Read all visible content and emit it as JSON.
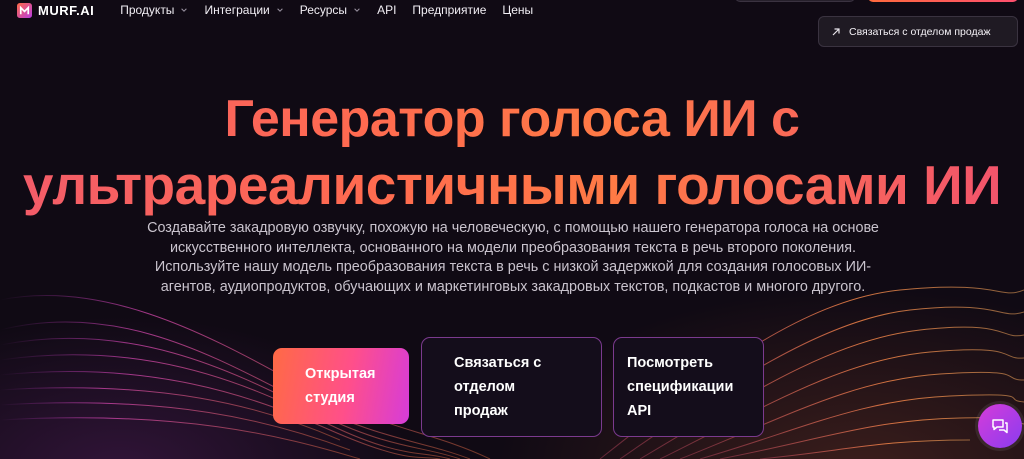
{
  "brand": {
    "name": "MURF.AI"
  },
  "nav": {
    "items": [
      {
        "label": "Продукты",
        "has_dropdown": true
      },
      {
        "label": "Интеграции",
        "has_dropdown": true
      },
      {
        "label": "Ресурсы",
        "has_dropdown": true
      },
      {
        "label": "API",
        "has_dropdown": false
      },
      {
        "label": "Предприятие",
        "has_dropdown": false
      },
      {
        "label": "Цены",
        "has_dropdown": false
      }
    ],
    "contact_sales": "Связаться с отделом продаж"
  },
  "hero": {
    "title_line1": "Генератор голоса ИИ с",
    "title_line2": "ультрареалистичными голосами ИИ",
    "description": "Создавайте закадровую озвучку, похожую на человеческую, с помощью нашего генератора голоса на основе искусственного интеллекта, основанного на модели преобразования текста в речь второго поколения. Используйте нашу модель преобразования текста в речь с низкой задержкой для создания голосовых ИИ-агентов, аудиопродуктов, обучающих и маркетинговых закадровых текстов, подкастов и многого другого."
  },
  "cta": {
    "open_studio_line1": "Открытая",
    "open_studio_line2": "студия",
    "contact_sales_line1": "Связаться с",
    "contact_sales_line2": "отделом",
    "contact_sales_line3": "продаж",
    "view_api_line1": "Посмотреть",
    "view_api_line2": "спецификации",
    "view_api_line3": "API"
  },
  "colors": {
    "accent_orange": "#ff6a45",
    "accent_pink": "#ff4f8a",
    "accent_purple": "#d63cd9",
    "background": "#100a14"
  },
  "icons": {
    "logo": "murf-logo-icon",
    "dropdown": "chevron-down-icon",
    "contact": "arrow-up-right-icon",
    "chat": "chat-bubble-icon"
  }
}
